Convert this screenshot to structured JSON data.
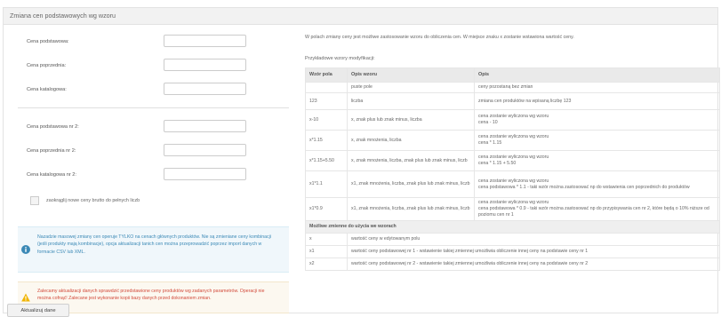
{
  "panel": {
    "title": "Zmiana cen podstawowych wg wzoru"
  },
  "form": {
    "fields_group1": [
      {
        "label": "Cena podstawowa:",
        "value": ""
      },
      {
        "label": "Cena poprzednia:",
        "value": ""
      },
      {
        "label": "Cena katalogowa:",
        "value": ""
      }
    ],
    "fields_group2": [
      {
        "label": "Cena podstawowa nr 2:",
        "value": ""
      },
      {
        "label": "Cena poprzednia nr 2:",
        "value": ""
      },
      {
        "label": "Cena katalogowa nr 2:",
        "value": ""
      }
    ],
    "checkbox_label": "zaokrąglij nowe ceny brutto do pełnych liczb",
    "info_text": "Nazadzie masowej zmiany cen operuje TYLKO na cenach głównych produktów. Nie są zmieniane ceny kombinacji (jeśli produkty mają kombinacje), opcja aktualizacji tanich cen można przeprowadzić poprzez import danych w formacie CSV lub XML.",
    "warning_text": "Zalecamy aktualizacji danych sprawdzić przedstawione ceny produktów wg zadanych parametrów. Operacji nie można cofnąć! Zalecane jest wykonanie kopii bazy danych przed dokonaniem zmian.",
    "update_button": "Aktualizuj dane"
  },
  "help": {
    "intro": "W polach zmiany ceny jest możliwe zastosowanie wzoru do obliczenia cen. W miejsce znaku x zostanie wstawiona wartość ceny.",
    "examples_title": "Przykładowe wzory modyfikacji:",
    "table": {
      "headers": [
        "Wzór pola",
        "Opis wzoru",
        "Opis"
      ],
      "rows": [
        {
          "formula": "",
          "desc": "puste pole",
          "result": "ceny pozostaną bez zmian"
        },
        {
          "formula": "123",
          "desc": "liczba",
          "result": "zmiana cen produktów na wpisaną liczbę 123"
        },
        {
          "formula": "x-10",
          "desc": "x, znak plus lub znak minus, liczba",
          "result": "cena zostanie wyliczona wg wzoru\ncena - 10"
        },
        {
          "formula": "x*1.15",
          "desc": "x, znak mnożenia, liczba",
          "result": "cena zostanie wyliczona wg wzoru\ncena * 1.15"
        },
        {
          "formula": "x*1.15+5.50",
          "desc": "x, znak mnożenia, liczba, znak plus lub znak minus, liczb",
          "result": "cena zostanie wyliczona wg wzoru\ncena * 1.15 + 5.50"
        },
        {
          "formula": "x1*1.1",
          "desc": "x1, znak mnożenia, liczba, znak plus lub znak minus, liczb",
          "result": "cena zostanie wyliczona wg wzoru\ncena podstawowa * 1.1 - taki wzór można zastosować np do wstawienia cen poprzednich do produktów"
        },
        {
          "formula": "x1*0.9",
          "desc": "x1, znak mnożenia, liczba, znak plus lub znak minus, liczb",
          "result": "cena zostanie wyliczona wg wzoru\ncena podstawowa * 0.9 - taki wzór można zastosować np do przypisywania cen nr 2, które będą o 10% niższe od poziomu cen nr 1"
        }
      ],
      "section_title": "Możliwe zmienne do użycia we wzorach",
      "variables": [
        {
          "name": "x",
          "desc": "wartość ceny w edytowanym polu"
        },
        {
          "name": "x1",
          "desc": "wartość ceny podstawowej nr 1 - wstawienie takiej zmiennej umożliwia obliczenie innej ceny na podstawie ceny nr 1"
        },
        {
          "name": "x2",
          "desc": "wartość ceny podstawowej nr 2 - wstawienie takiej zmiennej umożliwia obliczenie innej ceny na podstawie ceny nr 2"
        }
      ]
    }
  },
  "colors": {
    "info": "#3b89b6",
    "warning": "#d24a3a",
    "warning_icon": "#f0b400"
  },
  "icons": {
    "info": "info-circle-icon",
    "warning": "warning-triangle-icon"
  }
}
